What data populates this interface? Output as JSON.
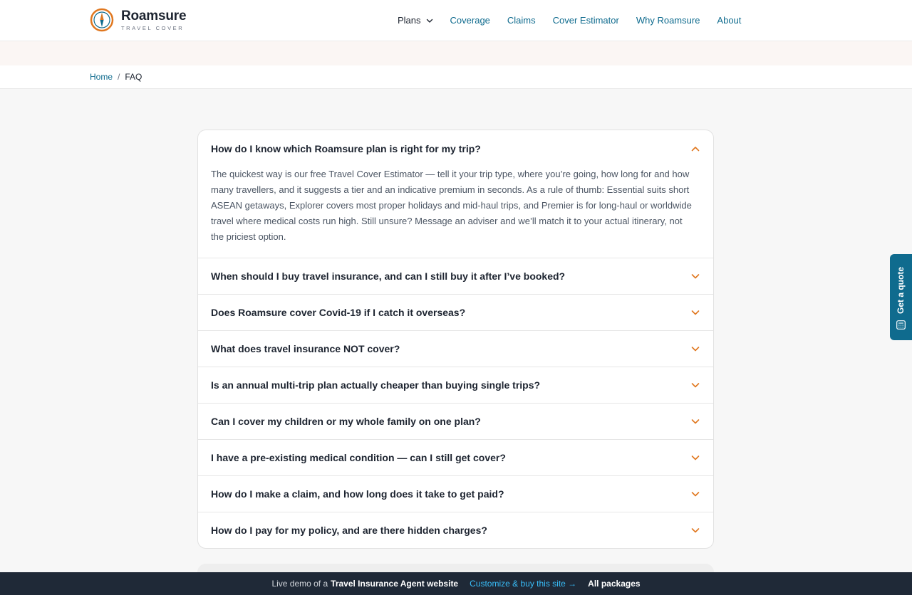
{
  "brand": {
    "name": "Roamsure",
    "tagline": "TRAVEL COVER",
    "accent": "#0f6b8e",
    "orange": "#e0771f"
  },
  "nav": {
    "items": [
      {
        "label": "Plans",
        "has_dropdown": true
      },
      {
        "label": "Coverage"
      },
      {
        "label": "Claims"
      },
      {
        "label": "Cover Estimator"
      },
      {
        "label": "Why Roamsure"
      },
      {
        "label": "About"
      }
    ]
  },
  "breadcrumb": {
    "home": "Home",
    "separator": "/",
    "current": "FAQ"
  },
  "faq": {
    "items": [
      {
        "question": "How do I know which Roamsure plan is right for my trip?",
        "answer": "The quickest way is our free Travel Cover Estimator — tell it your trip type, where you’re going, how long for and how many travellers, and it suggests a tier and an indicative premium in seconds. As a rule of thumb: Essential suits short ASEAN getaways, Explorer covers most proper holidays and mid-haul trips, and Premier is for long-haul or worldwide travel where medical costs run high. Still unsure? Message an adviser and we’ll match it to your actual itinerary, not the priciest option.",
        "open": true
      },
      {
        "question": "When should I buy travel insurance, and can I still buy it after I’ve booked?",
        "open": false
      },
      {
        "question": "Does Roamsure cover Covid-19 if I catch it overseas?",
        "open": false
      },
      {
        "question": "What does travel insurance NOT cover?",
        "open": false
      },
      {
        "question": "Is an annual multi-trip plan actually cheaper than buying single trips?",
        "open": false
      },
      {
        "question": "Can I cover my children or my whole family on one plan?",
        "open": false
      },
      {
        "question": "I have a pre-existing medical condition — can I still get cover?",
        "open": false
      },
      {
        "question": "How do I make a claim, and how long does it take to get paid?",
        "open": false
      },
      {
        "question": "How do I pay for my policy, and are there hidden charges?",
        "open": false
      }
    ]
  },
  "side_tab": {
    "label": "Get a quote",
    "icon": "calculator-icon"
  },
  "demo_bar": {
    "prefix": "Live demo of a",
    "site_type": "Travel Insurance Agent website",
    "cta": "Customize & buy this site →",
    "packages": "All packages"
  }
}
